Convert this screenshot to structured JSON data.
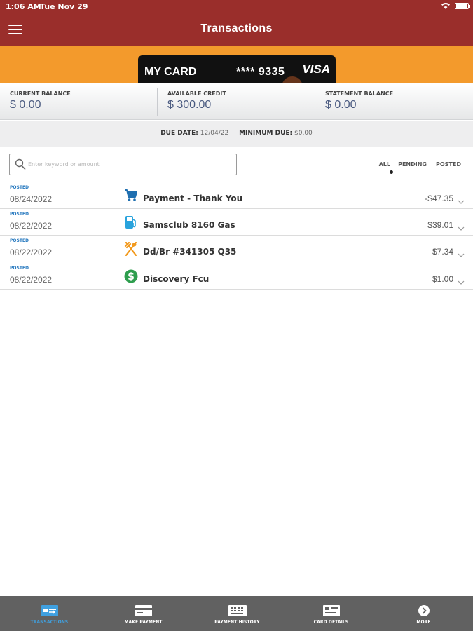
{
  "status_bar": {
    "time": "1:06 AM",
    "date": "Tue Nov 29"
  },
  "header": {
    "title": "Transactions"
  },
  "card": {
    "name": "MY CARD",
    "number": "**** 9335",
    "brand": "VISA"
  },
  "balances": [
    {
      "label": "CURRENT BALANCE",
      "value": "$ 0.00"
    },
    {
      "label": "AVAILABLE CREDIT",
      "value": "$ 300.00"
    },
    {
      "label": "STATEMENT BALANCE",
      "value": "$ 0.00"
    }
  ],
  "due": {
    "date_label": "DUE DATE:",
    "date_value": "12/04/22",
    "min_label": "MINIMUM DUE:",
    "min_value": "$0.00"
  },
  "search": {
    "placeholder": "Enter keyword or amount"
  },
  "filters": {
    "all": "ALL",
    "pending": "PENDING",
    "posted": "POSTED",
    "selected": "ALL"
  },
  "transactions": [
    {
      "status": "POSTED",
      "date": "08/24/2022",
      "icon": "shopping-cart-icon",
      "description": "Payment - Thank You",
      "amount": "-$47.35"
    },
    {
      "status": "POSTED",
      "date": "08/22/2022",
      "icon": "gas-station-icon",
      "description": "Samsclub 8160 Gas",
      "amount": "$39.01"
    },
    {
      "status": "POSTED",
      "date": "08/22/2022",
      "icon": "restaurant-icon",
      "description": "Dd/Br #341305 Q35",
      "amount": "$7.34"
    },
    {
      "status": "POSTED",
      "date": "08/22/2022",
      "icon": "dollar-icon",
      "description": "Discovery Fcu",
      "amount": "$1.00"
    }
  ],
  "tabs": [
    {
      "label": "TRANSACTIONS",
      "icon": "transactions-icon",
      "active": true
    },
    {
      "label": "MAKE PAYMENT",
      "icon": "make-payment-icon",
      "active": false
    },
    {
      "label": "PAYMENT HISTORY",
      "icon": "payment-history-icon",
      "active": false
    },
    {
      "label": "CARD DETAILS",
      "icon": "card-details-icon",
      "active": false
    },
    {
      "label": "MORE",
      "icon": "more-icon",
      "active": false
    }
  ],
  "colors": {
    "header": "#9a2e2b",
    "banner": "#f39a2c",
    "accent_blue": "#2a7bc0",
    "tab_bar": "#616161",
    "active_tab": "#3fa0e0"
  }
}
